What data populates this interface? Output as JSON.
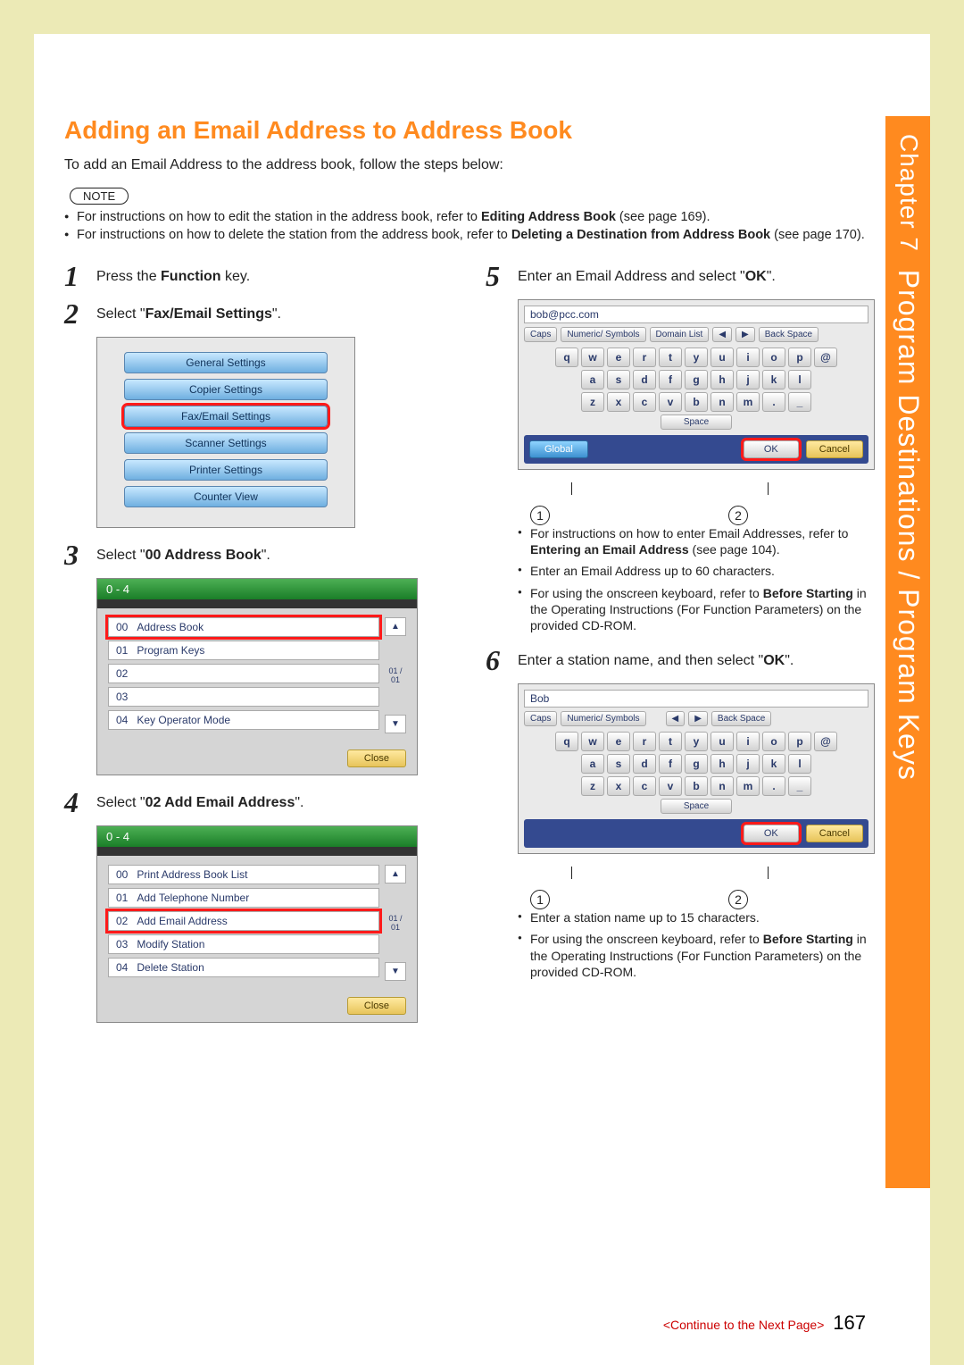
{
  "chapter": {
    "label": "Chapter 7",
    "title": "Program Destinations / Program Keys"
  },
  "heading": "Adding an Email Address to Address Book",
  "intro": "To add an Email Address to the address book, follow the steps below:",
  "note_label": "NOTE",
  "notes": [
    {
      "pre": "For instructions on how to edit the station in the address book, refer to ",
      "b": "Editing Address Book",
      "post": " (see page 169)."
    },
    {
      "pre": "For instructions on how to delete the station from the address book, refer to ",
      "b": "Deleting a Destination from Address Book",
      "post": " (see page 170)."
    }
  ],
  "steps": {
    "s1": {
      "pre": "Press the ",
      "b": "Function",
      "post": " key."
    },
    "s2": {
      "pre": "Select \"",
      "b": "Fax/Email Settings",
      "post": "\"."
    },
    "s3": {
      "pre": "Select \"",
      "b": "00 Address Book",
      "post": "\"."
    },
    "s4": {
      "pre": "Select \"",
      "b": "02 Add Email Address",
      "post": "\"."
    },
    "s5": {
      "pre": "Enter an Email Address and select \"",
      "b": "OK",
      "post": "\"."
    },
    "s6": {
      "pre": "Enter a station name, and then select \"",
      "b": "OK",
      "post": "\"."
    }
  },
  "settings_menu": [
    "General Settings",
    "Copier Settings",
    "Fax/Email Settings",
    "Scanner Settings",
    "Printer Settings",
    "Counter View"
  ],
  "list_panel_3": {
    "header": "0  -  4",
    "rows": [
      {
        "code": "00",
        "label": "Address Book"
      },
      {
        "code": "01",
        "label": "Program Keys"
      },
      {
        "code": "02",
        "label": ""
      },
      {
        "code": "03",
        "label": ""
      },
      {
        "code": "04",
        "label": "Key Operator Mode"
      }
    ],
    "scroll": "01 / 01",
    "close": "Close"
  },
  "list_panel_4": {
    "header": "0  -  4",
    "rows": [
      {
        "code": "00",
        "label": "Print Address Book List"
      },
      {
        "code": "01",
        "label": "Add Telephone Number"
      },
      {
        "code": "02",
        "label": "Add Email Address"
      },
      {
        "code": "03",
        "label": "Modify Station"
      },
      {
        "code": "04",
        "label": "Delete Station"
      }
    ],
    "scroll": "01 / 01",
    "close": "Close"
  },
  "keyboard": {
    "input5": "bob@pcc.com",
    "input6": "Bob",
    "toprow": {
      "caps": "Caps",
      "numsym": "Numeric/ Symbols",
      "domain": "Domain List",
      "left": "◀",
      "right": "▶",
      "back": "Back Space"
    },
    "row1": [
      "q",
      "w",
      "e",
      "r",
      "t",
      "y",
      "u",
      "i",
      "o",
      "p",
      "@"
    ],
    "row2": [
      "a",
      "s",
      "d",
      "f",
      "g",
      "h",
      "j",
      "k",
      "l"
    ],
    "row3": [
      "z",
      "x",
      "c",
      "v",
      "b",
      "n",
      "m",
      ".",
      "_"
    ],
    "space": "Space",
    "global": "Global",
    "ok": "OK",
    "cancel": "Cancel"
  },
  "bullets5": [
    {
      "pre": "For instructions on how to enter Email Addresses, refer to ",
      "b": "Entering an Email Address",
      "post": " (see page 104)."
    },
    {
      "pre": "Enter an Email Address up to 60 characters.",
      "b": "",
      "post": ""
    },
    {
      "pre": "For using the onscreen keyboard, refer to ",
      "b": "Before Starting",
      "post": " in the Operating Instructions (For Function Parameters) on the provided CD-ROM."
    }
  ],
  "bullets6": [
    {
      "pre": "Enter a station name up to 15 characters.",
      "b": "",
      "post": ""
    },
    {
      "pre": "For using the onscreen keyboard, refer to ",
      "b": "Before Starting",
      "post": " in the Operating Instructions (For Function Parameters) on the provided CD-ROM."
    }
  ],
  "callouts": [
    "1",
    "2"
  ],
  "footer": {
    "continue": "<Continue to the Next Page>",
    "page": "167"
  }
}
